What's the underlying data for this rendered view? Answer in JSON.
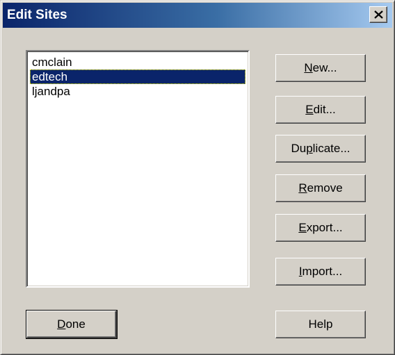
{
  "window": {
    "title": "Edit Sites"
  },
  "list": {
    "items": [
      {
        "label": "cmclain",
        "selected": false
      },
      {
        "label": "edtech",
        "selected": true
      },
      {
        "label": "ljandpa",
        "selected": false
      }
    ]
  },
  "buttons": {
    "new": {
      "pre": "",
      "key": "N",
      "post": "ew..."
    },
    "edit": {
      "pre": "",
      "key": "E",
      "post": "dit..."
    },
    "duplicate": {
      "pre": "Du",
      "key": "p",
      "post": "licate..."
    },
    "remove": {
      "pre": "",
      "key": "R",
      "post": "emove"
    },
    "export": {
      "pre": "",
      "key": "E",
      "post": "xport..."
    },
    "import": {
      "pre": "",
      "key": "I",
      "post": "mport..."
    },
    "done": {
      "pre": "",
      "key": "D",
      "post": "one"
    },
    "help": {
      "label": "Help"
    }
  },
  "icons": {
    "close": "close-icon"
  },
  "colors": {
    "titlebar_start": "#0a246a",
    "titlebar_end": "#a6caf0",
    "face": "#d4d0c8",
    "selection": "#0a246a"
  }
}
